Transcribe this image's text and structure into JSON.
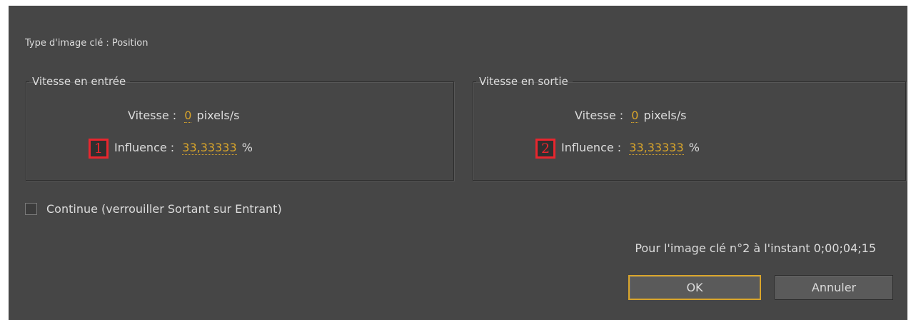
{
  "dialog": {
    "keyframe_type": "Type d'image clé : Position",
    "incoming": {
      "title": "Vitesse en entrée",
      "speed_label": "Vitesse :",
      "speed_value": "0",
      "speed_unit": "pixels/s",
      "influence_label": "Influence :",
      "influence_value": "33,33333",
      "influence_unit": "%",
      "marker": "1"
    },
    "outgoing": {
      "title": "Vitesse en sortie",
      "speed_label": "Vitesse :",
      "speed_value": "0",
      "speed_unit": "pixels/s",
      "influence_label": "Influence :",
      "influence_value": "33,33333",
      "influence_unit": "%",
      "marker": "2"
    },
    "continuous_label": "Continue (verrouiller Sortant sur Entrant)",
    "continuous_checked": false,
    "instant_text": "Pour l'image clé n°2 à l'instant 0;00;04;15",
    "ok_label": "OK",
    "cancel_label": "Annuler"
  },
  "colors": {
    "background": "#464646",
    "accent_value": "#d9a52b",
    "marker": "#e8262e"
  }
}
